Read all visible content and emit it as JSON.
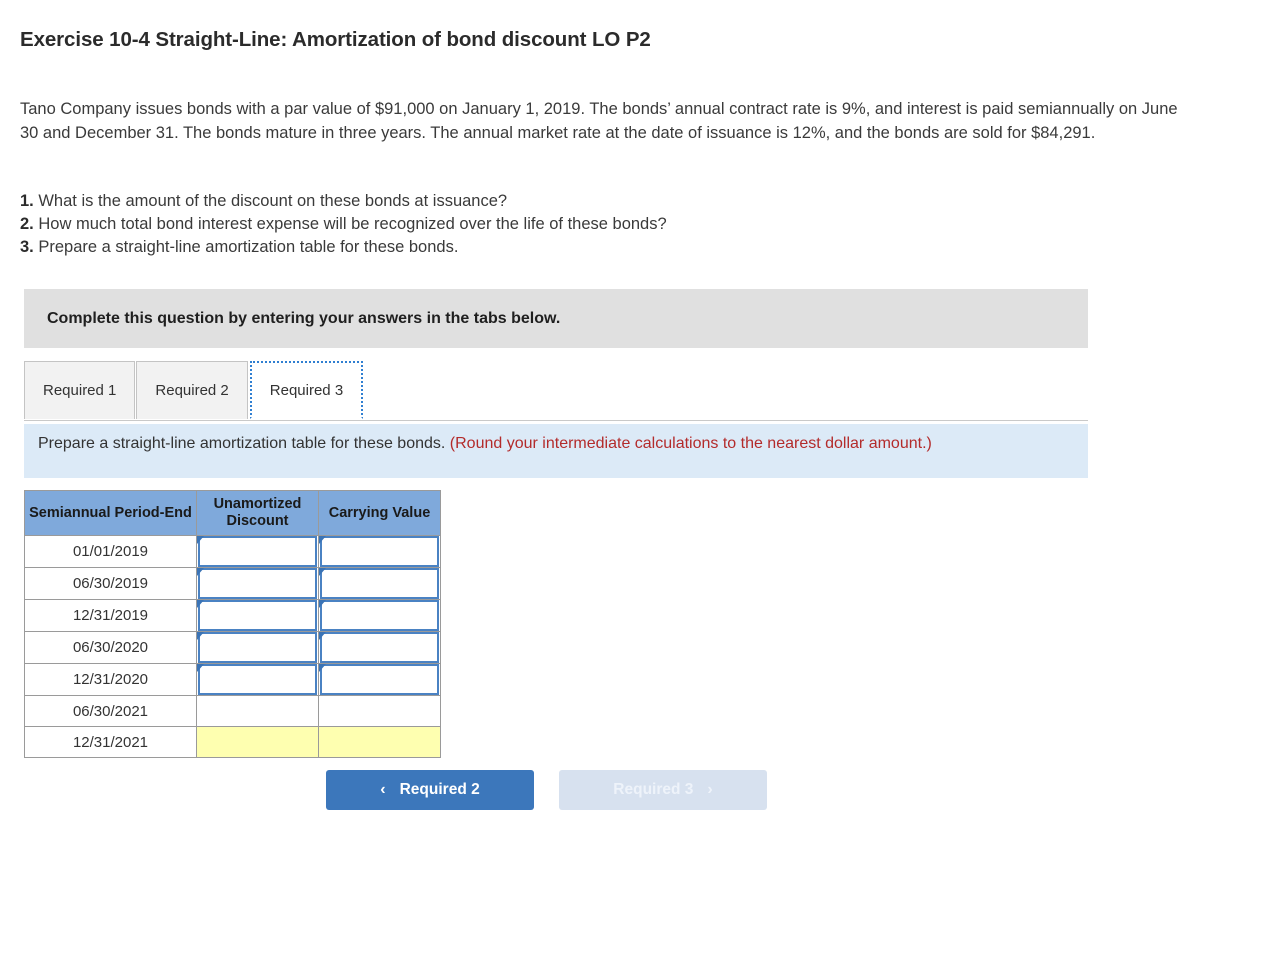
{
  "exercise": {
    "title": "Exercise 10-4 Straight-Line: Amortization of bond discount LO P2",
    "intro": "Tano Company issues bonds with a par value of $91,000 on January 1, 2019. The bonds’ annual contract rate is 9%, and interest is paid semiannually on June 30 and December 31. The bonds mature in three years. The annual market rate at the date of issuance is 12%, and the bonds are sold for $84,291.",
    "requirements": [
      {
        "num": "1.",
        "text": "What is the amount of the discount on these bonds at issuance?"
      },
      {
        "num": "2.",
        "text": "How much total bond interest expense will be recognized over the life of these bonds?"
      },
      {
        "num": "3.",
        "text": "Prepare a straight-line amortization table for these bonds."
      }
    ]
  },
  "banner": {
    "text": "Complete this question by entering your answers in the tabs below."
  },
  "tabs": [
    {
      "label": "Required 1",
      "active": false
    },
    {
      "label": "Required 2",
      "active": false
    },
    {
      "label": "Required 3",
      "active": true
    }
  ],
  "instruction": {
    "main": "Prepare a straight-line amortization table for these bonds.",
    "warning": "(Round your intermediate calculations to the nearest dollar amount.)"
  },
  "table": {
    "headers": [
      "Semiannual Period-End",
      "Unamortized Discount",
      "Carrying Value"
    ],
    "rows": [
      {
        "period": "01/01/2019",
        "discount": "",
        "carrying": "",
        "type": "input"
      },
      {
        "period": "06/30/2019",
        "discount": "",
        "carrying": "",
        "type": "input"
      },
      {
        "period": "12/31/2019",
        "discount": "",
        "carrying": "",
        "type": "input"
      },
      {
        "period": "06/30/2020",
        "discount": "",
        "carrying": "",
        "type": "input"
      },
      {
        "period": "12/31/2020",
        "discount": "",
        "carrying": "",
        "type": "input"
      },
      {
        "period": "06/30/2021",
        "discount": "",
        "carrying": "",
        "type": "blank"
      },
      {
        "period": "12/31/2021",
        "discount": "",
        "carrying": "",
        "type": "yellow"
      }
    ]
  },
  "nav": {
    "prev_label": "Required 2",
    "prev_icon": "chevron-left-icon",
    "prev_chevron": "‹",
    "next_label": "Required 3",
    "next_icon": "chevron-right-icon",
    "next_chevron": "›"
  },
  "colors": {
    "header_blue": "#7fa9db",
    "strip_blue": "#dceaf7",
    "banner_gray": "#e0e0e0",
    "warning_red": "#b32b2b",
    "button_blue": "#3c77bb",
    "button_disabled": "#d7e1ef",
    "yellow_cell": "#feffb0",
    "input_border": "#4a82c3"
  }
}
